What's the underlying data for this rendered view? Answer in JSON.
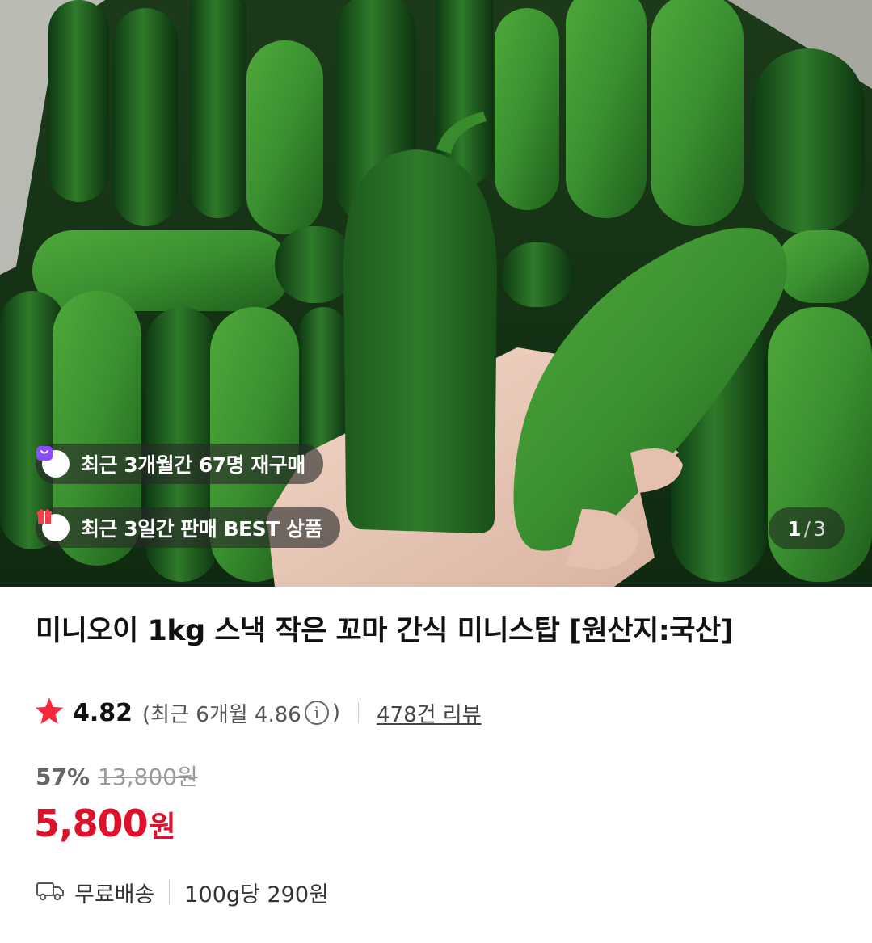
{
  "gallery": {
    "badges": [
      {
        "text": "최근 3개월간 67명 재구매",
        "icon": "shopping-bag-icon",
        "icon_color": "#8a4dff"
      },
      {
        "text": "최근 3일간 판매 BEST 상품",
        "icon": "gift-box-icon",
        "icon_color": "#ff3b4a"
      }
    ],
    "counter": {
      "current": "1",
      "separator": "/",
      "total": "3"
    }
  },
  "product": {
    "title": "미니오이 1kg 스낵 작은 꼬마 간식 미니스탑 [원산지:국산]",
    "rating": {
      "icon": "star-icon",
      "star_color": "#f5283c",
      "score": "4.82",
      "recent_prefix": "(최근 6개월 4.86",
      "recent_suffix": ")",
      "info_icon": "info-icon",
      "review_count": "478건 리뷰"
    },
    "pricing": {
      "discount": "57%",
      "original_price": "13,800원",
      "price": "5,800",
      "currency": "원",
      "price_color": "#e0102a"
    },
    "shipping": {
      "icon": "truck-icon",
      "label": "무료배송",
      "unit_price": "100g당 290원"
    }
  }
}
